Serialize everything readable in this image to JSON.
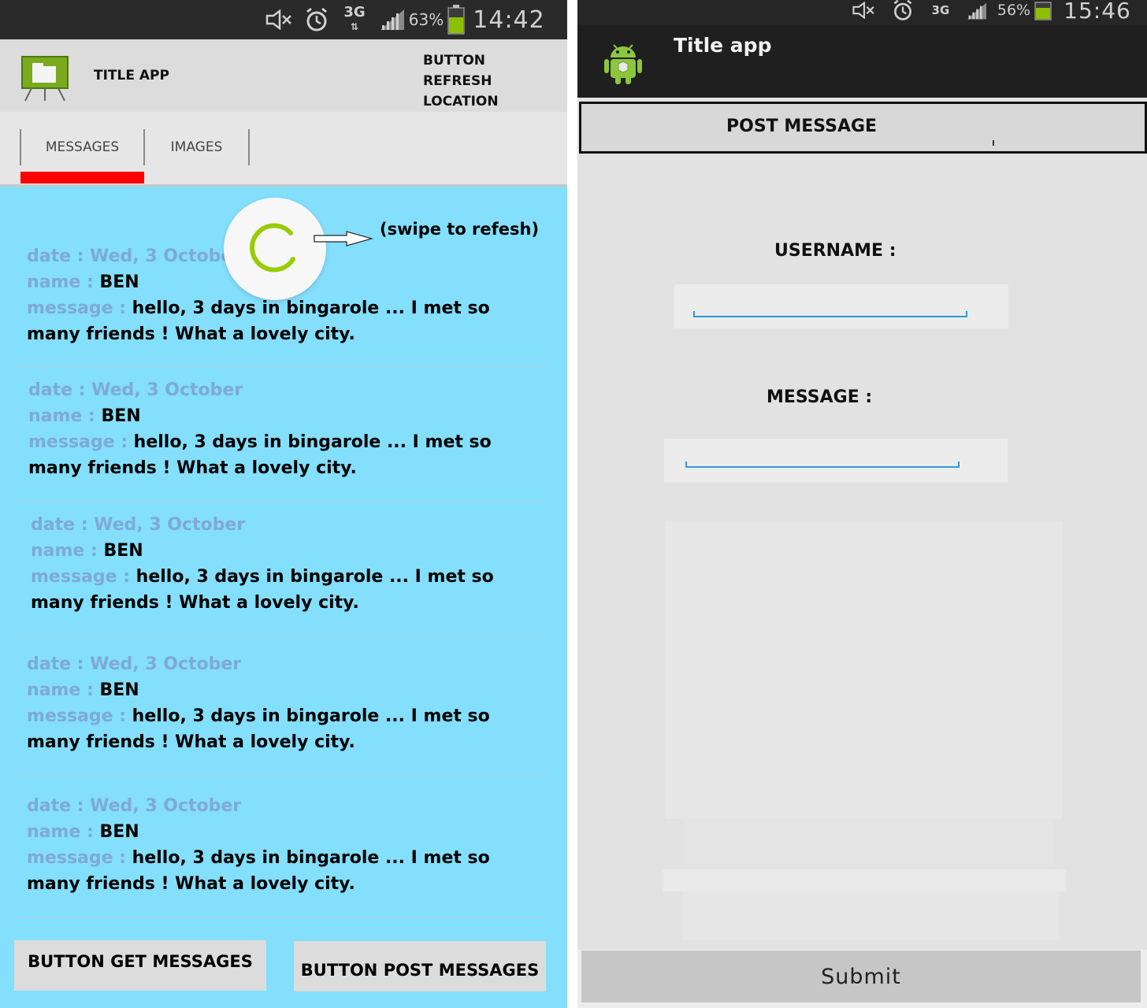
{
  "left": {
    "status": {
      "battery": "63%",
      "time": "14:42",
      "network": "3G"
    },
    "appbar": {
      "title": "TITLE APP",
      "refresh_button": "BUTTON REFRESH LOCATION"
    },
    "tabs": [
      {
        "label": "MESSAGES",
        "selected": true
      },
      {
        "label": "IMAGES",
        "selected": false
      }
    ],
    "refresh_hint": "(swipe to refesh)",
    "messages": [
      {
        "date_label": "date : ",
        "date": "Wed, 3 October",
        "name_label": "name : ",
        "name": "BEN",
        "message_label": "message : ",
        "message": "hello, 3 days in bingarole ... I met so many friends ! What a lovely city."
      },
      {
        "date_label": "date : ",
        "date": "Wed, 3 October",
        "name_label": "name : ",
        "name": "BEN",
        "message_label": "message : ",
        "message": "hello, 3 days in bingarole ... I met so many friends ! What a lovely city."
      },
      {
        "date_label": "date : ",
        "date": "Wed, 3 October",
        "name_label": "name : ",
        "name": "BEN",
        "message_label": "message : ",
        "message": "hello, 3 days in bingarole ... I met so many friends ! What a lovely city."
      },
      {
        "date_label": "date : ",
        "date": "Wed, 3 October",
        "name_label": "name : ",
        "name": "BEN",
        "message_label": "message : ",
        "message": "hello, 3 days in bingarole ... I met so many friends ! What a lovely city."
      },
      {
        "date_label": "date : ",
        "date": "Wed, 3 October",
        "name_label": "name : ",
        "name": "BEN",
        "message_label": "message : ",
        "message": "hello, 3 days in bingarole ... I met so many friends ! What a lovely city."
      }
    ],
    "buttons": {
      "get": "BUTTON GET MESSAGES",
      "post": "BUTTON POST MESSAGES"
    },
    "colors": {
      "list_bg": "#83dffc",
      "label": "#7eaad6",
      "tab_indicator": "#ff0000",
      "spinner": "#99cc00"
    }
  },
  "right": {
    "status": {
      "battery": "56%",
      "time": "15:46",
      "network": "3G"
    },
    "appbar": {
      "title": "Title app"
    },
    "section_title": "POST MESSAGE",
    "username_label": "USERNAME :",
    "message_label": "MESSAGE :",
    "submit_label": "Submit",
    "colors": {
      "appbar_bg": "#1f1f1f",
      "underline": "#2f9ad6"
    }
  }
}
